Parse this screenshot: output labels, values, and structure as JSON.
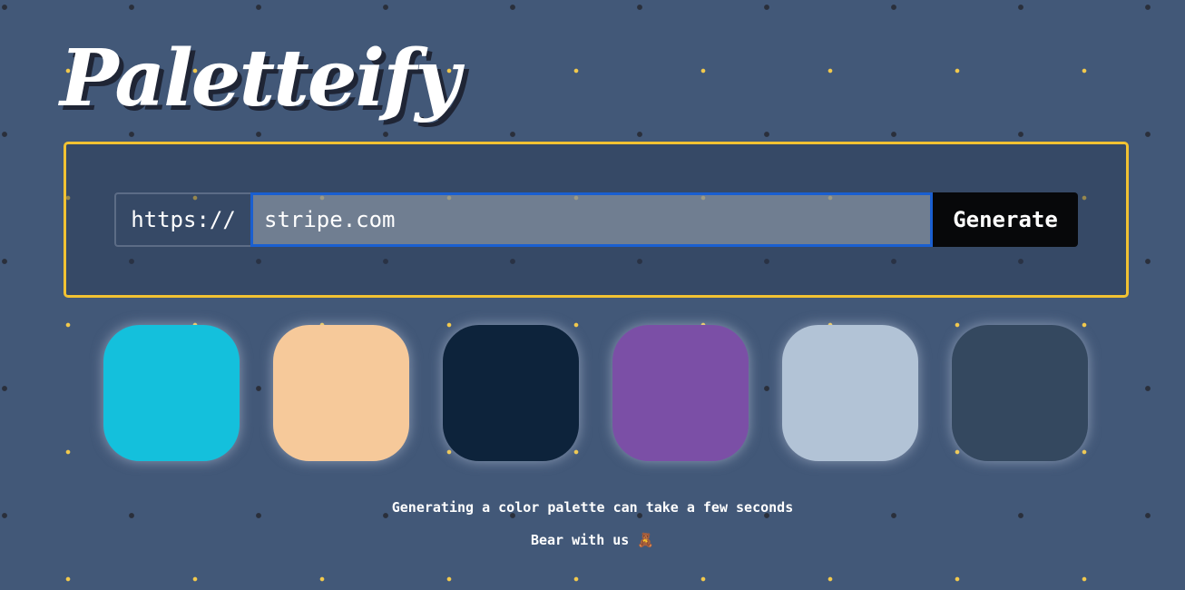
{
  "app": {
    "title": "Paletteify"
  },
  "form": {
    "prefix": "https://",
    "url_value": "stripe.com",
    "url_placeholder": "",
    "generate_label": "Generate"
  },
  "palette": [
    {
      "name": "cyan",
      "color": "#14c0dc"
    },
    {
      "name": "peach",
      "color": "#f6c99a"
    },
    {
      "name": "navy",
      "color": "#0d233b"
    },
    {
      "name": "purple",
      "color": "#7b4fa6"
    },
    {
      "name": "light-blue-gray",
      "color": "#b2c3d6"
    },
    {
      "name": "slate",
      "color": "#34485f"
    }
  ],
  "messages": {
    "line1": "Generating a color palette can take a few seconds",
    "line2": "Bear with us 🧸"
  },
  "colors": {
    "background": "#425878",
    "panel_border": "#f2c232",
    "input_focus": "#1a5fd0",
    "button": "#07080a"
  }
}
